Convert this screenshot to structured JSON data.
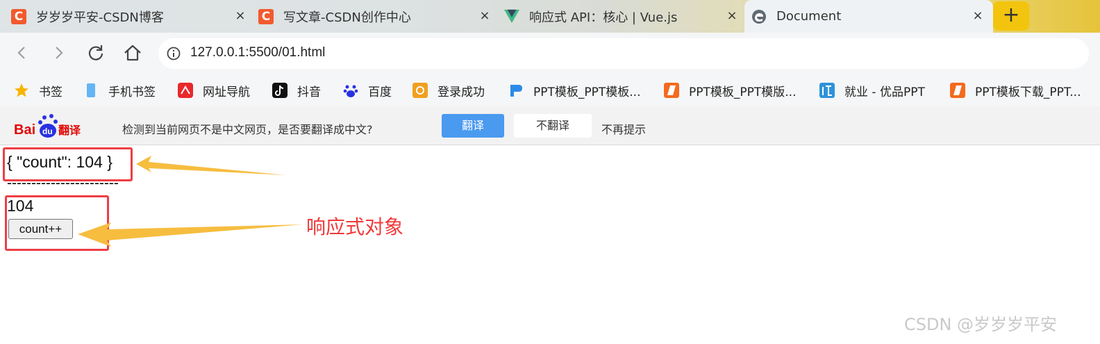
{
  "browser": {
    "tabs": [
      {
        "title": "岁岁岁平安-CSDN博客",
        "favicon": "csdn-icon",
        "active": false
      },
      {
        "title": "写文章-CSDN创作中心",
        "favicon": "csdn-icon",
        "active": false
      },
      {
        "title": "响应式 API：核心 | Vue.js",
        "favicon": "vue-icon",
        "active": false
      },
      {
        "title": "Document",
        "favicon": "edge-icon",
        "active": true
      }
    ],
    "favicon_letter": "C",
    "close_glyph": "×",
    "new_tab_glyph": "+",
    "url": "127.0.0.1:5500/01.html",
    "bookmarks": [
      {
        "label": "书签",
        "icon": "star-icon"
      },
      {
        "label": "手机书签",
        "icon": "phone-icon"
      },
      {
        "label": "网址导航",
        "icon": "nav-icon"
      },
      {
        "label": "抖音",
        "icon": "tiktok-icon"
      },
      {
        "label": "百度",
        "icon": "baidu-paw-icon"
      },
      {
        "label": "登录成功",
        "icon": "ep-icon"
      },
      {
        "label": "PPT模板_PPT模板...",
        "icon": "ppt-blue-icon"
      },
      {
        "label": "PPT模板_PPT模版...",
        "icon": "ppt-orange-icon"
      },
      {
        "label": "就业 - 优品PPT",
        "icon": "youpin-icon"
      },
      {
        "label": "PPT模板下载_PPT...",
        "icon": "ppt-orange-icon"
      }
    ]
  },
  "translate_bar": {
    "logo": "Baidu翻译",
    "message": "检测到当前网页不是中文网页，是否要翻译成中文?",
    "translate_button": "翻译",
    "no_translate_button": "不翻译",
    "never_prompt": "不再提示"
  },
  "page": {
    "json_display": "{ \"count\": 104 }",
    "divider": "-----------------------",
    "count_value": "104",
    "button_label": "count++"
  },
  "annotation": {
    "label": "响应式对象",
    "color": "#ef3a3a",
    "highlight_color": "#ee3e44",
    "arrow_color": "#f6bd3f"
  },
  "watermark": "CSDN @岁岁岁平安"
}
